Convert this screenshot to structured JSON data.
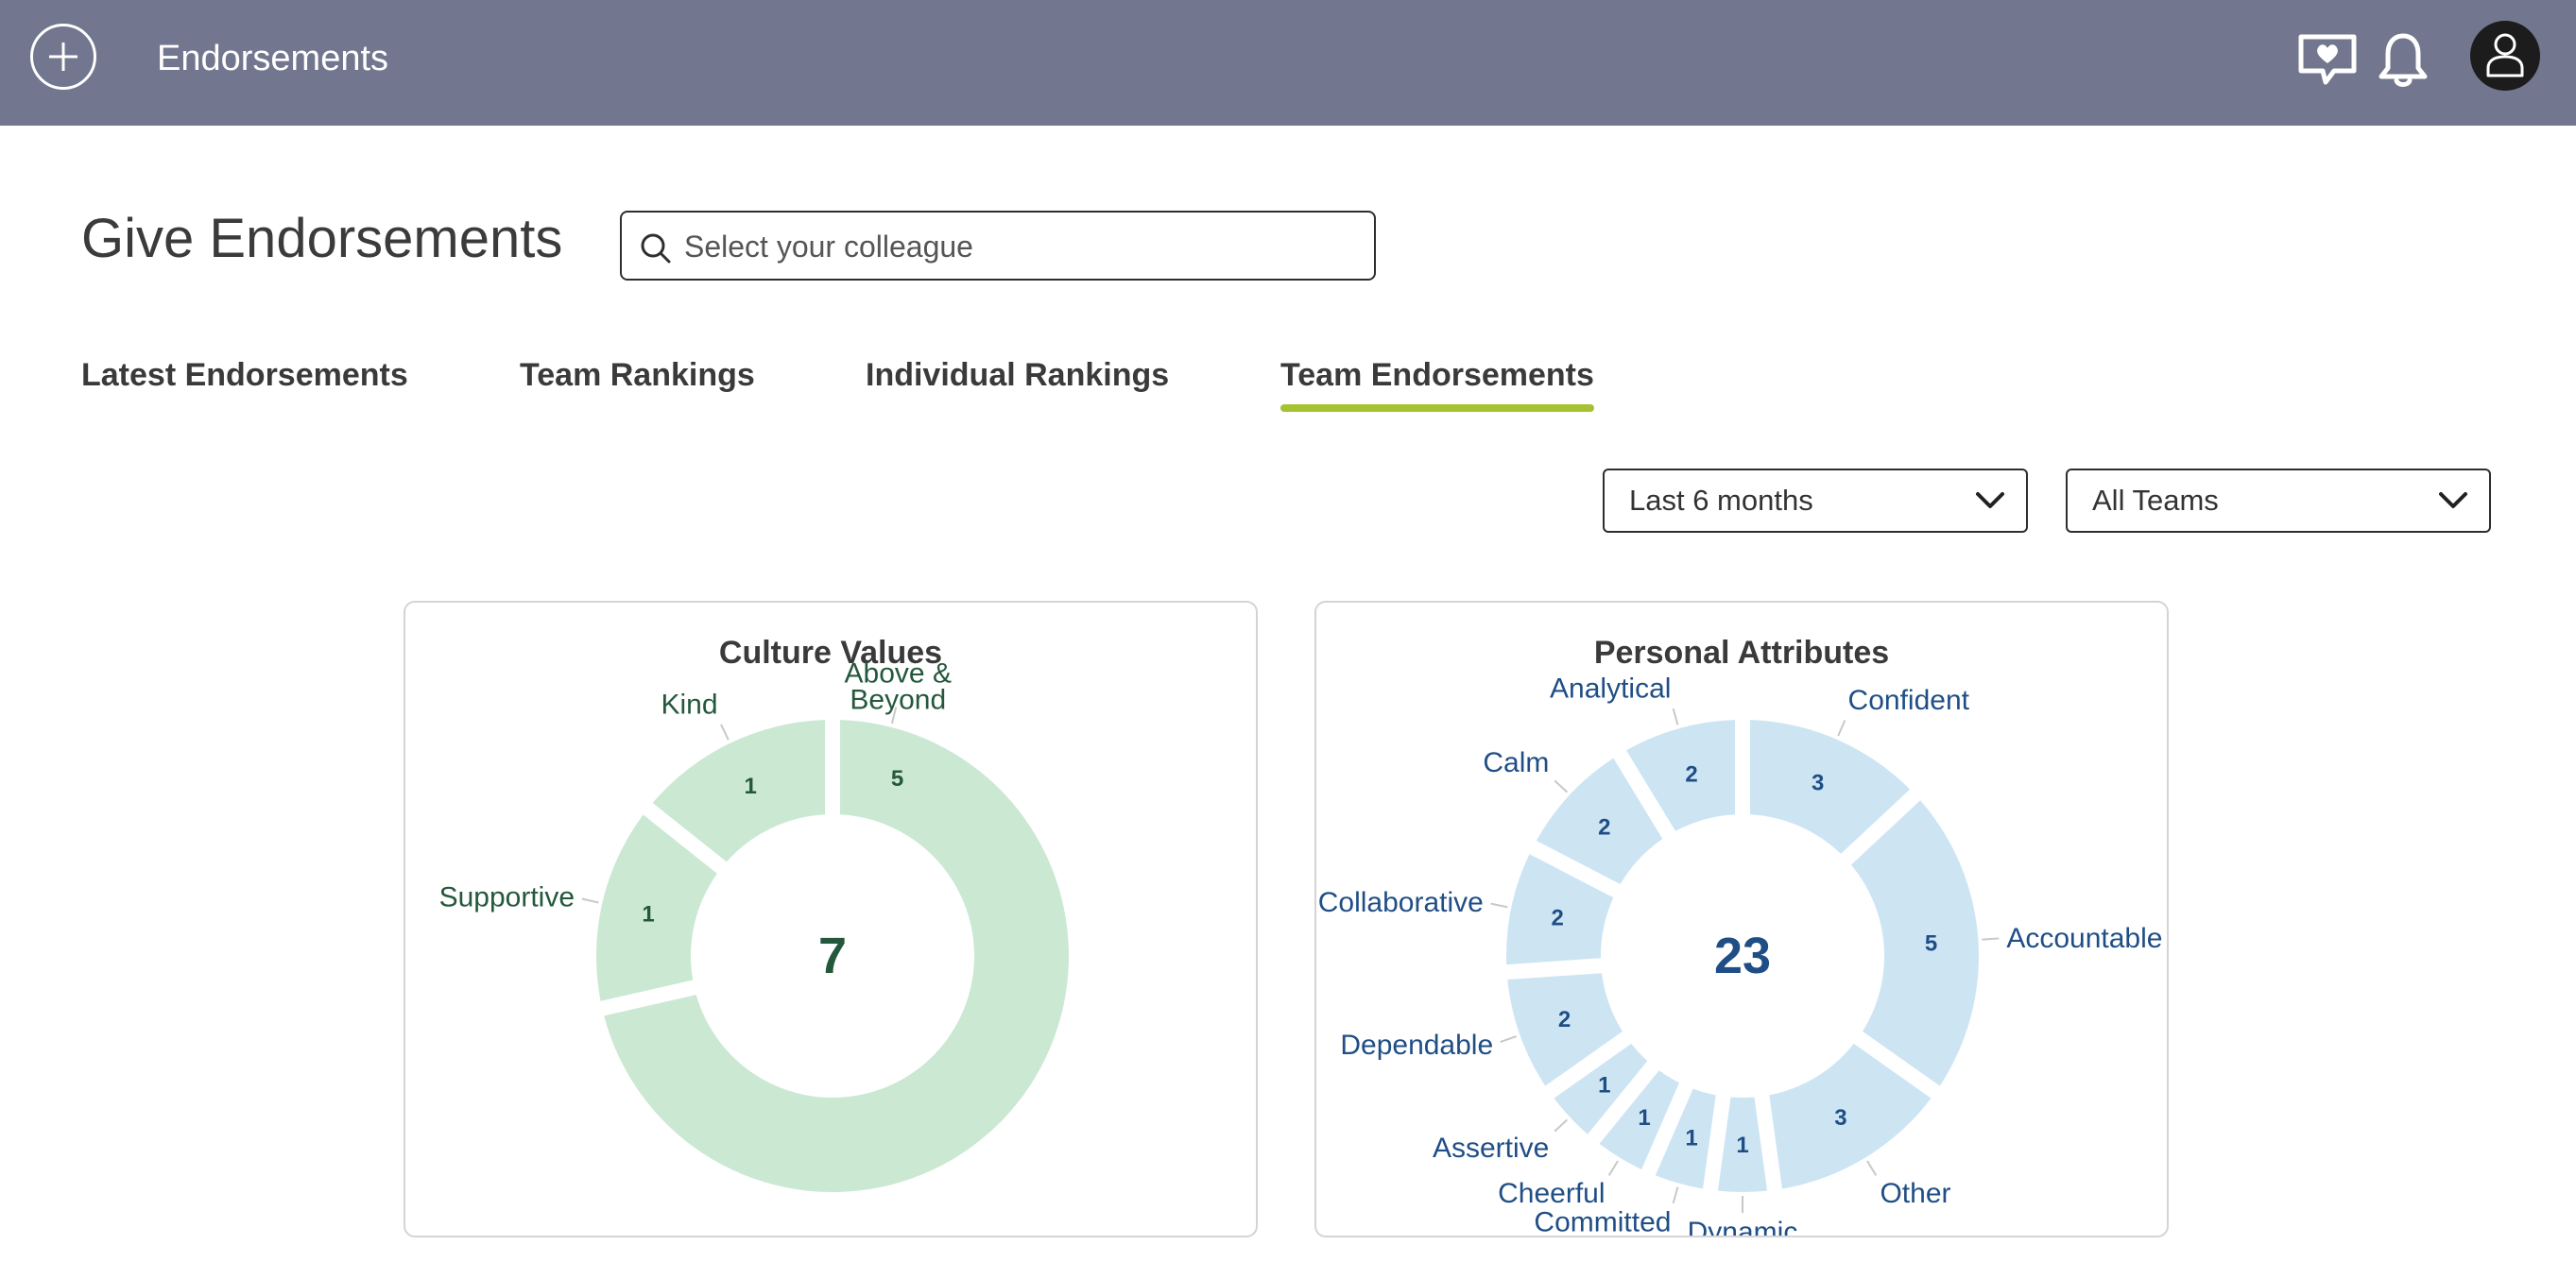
{
  "header": {
    "title": "Endorsements",
    "icons": [
      "plus-circle-icon",
      "heart-message-icon",
      "bell-icon",
      "user-icon"
    ],
    "bar_color": "#72768e"
  },
  "main": {
    "title": "Give Endorsements",
    "search": {
      "placeholder": "Select your colleague",
      "value": ""
    },
    "tabs": [
      {
        "label": "Latest Endorsements",
        "active": false
      },
      {
        "label": "Team Rankings",
        "active": false
      },
      {
        "label": "Individual Rankings",
        "active": false
      },
      {
        "label": "Team Endorsements",
        "active": true
      }
    ],
    "active_tab_color": "#a6c232",
    "filters": {
      "period": "Last 6 months",
      "team": "All Teams"
    }
  },
  "chart_data": [
    {
      "type": "donut",
      "title": "Culture Values",
      "total": "7",
      "color": "#cbe8d3",
      "text_color": "#24583c",
      "slices": [
        {
          "label": "Above & Beyond",
          "value": 5
        },
        {
          "label": "Supportive",
          "value": 1
        },
        {
          "label": "Kind",
          "value": 1
        }
      ]
    },
    {
      "type": "donut",
      "title": "Personal Attributes",
      "total": "23",
      "color": "#cde5f3",
      "text_color": "#1f4e86",
      "slices": [
        {
          "label": "Confident",
          "value": 3
        },
        {
          "label": "Accountable",
          "value": 5
        },
        {
          "label": "Other",
          "value": 3
        },
        {
          "label": "Dynamic",
          "value": 1
        },
        {
          "label": "Committed",
          "value": 1
        },
        {
          "label": "Cheerful",
          "value": 1
        },
        {
          "label": "Assertive",
          "value": 1
        },
        {
          "label": "Dependable",
          "value": 2
        },
        {
          "label": "Collaborative",
          "value": 2
        },
        {
          "label": "Calm",
          "value": 2
        },
        {
          "label": "Analytical",
          "value": 2
        }
      ]
    }
  ]
}
